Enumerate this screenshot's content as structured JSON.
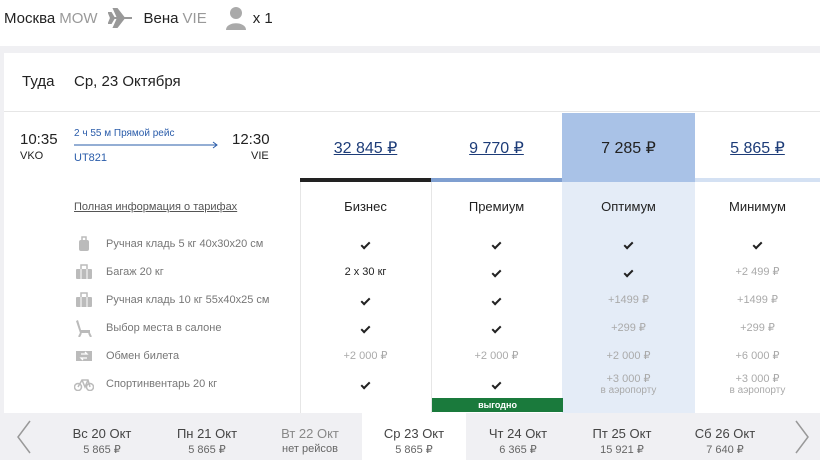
{
  "route": {
    "from_city": "Москва",
    "from_code": "MOW",
    "to_city": "Вена",
    "to_code": "VIE",
    "passengers": "x 1"
  },
  "direction": {
    "label": "Туда",
    "date": "Ср, 23 Октября"
  },
  "flight": {
    "dep_time": "10:35",
    "dep_code": "VKO",
    "arr_time": "12:30",
    "arr_code": "VIE",
    "duration": "2 ч 55 м  Прямой рейс",
    "number": "UT821"
  },
  "fares": [
    {
      "name": "Бизнес",
      "price": "32 845 ₽",
      "color": "#222222"
    },
    {
      "name": "Премиум",
      "price": "9 770 ₽",
      "color": "#7f9fd0"
    },
    {
      "name": "Оптимум",
      "price": "7 285 ₽",
      "color": "#a9c2e7"
    },
    {
      "name": "Минимум",
      "price": "5 865 ₽",
      "color": "#d4e1f3"
    }
  ],
  "info_link": "Полная информация о тарифах",
  "features": [
    {
      "icon": "hand-luggage-icon",
      "label": "Ручная кладь 5 кг 40x30x20 см"
    },
    {
      "icon": "baggage-icon",
      "label": "Багаж 20 кг"
    },
    {
      "icon": "suitcase-icon",
      "label": "Ручная кладь 10 кг 55x40x25 см"
    },
    {
      "icon": "seat-icon",
      "label": "Выбор места в салоне"
    },
    {
      "icon": "ticket-exchange-icon",
      "label": "Обмен билета"
    },
    {
      "icon": "bicycle-icon",
      "label": "Спортинвентарь 20 кг"
    }
  ],
  "cells": {
    "business": [
      "check",
      "2 x 30 кг",
      "check",
      "check",
      "+2 000 ₽",
      "check"
    ],
    "premium": [
      "check",
      "check",
      "check",
      "check",
      "+2 000 ₽",
      "check"
    ],
    "optimum": [
      "check",
      "check",
      "+1499 ₽",
      "+299 ₽",
      "+2 000 ₽",
      "+3 000 ₽"
    ],
    "minimum": [
      "check",
      "+2 499 ₽",
      "+1499 ₽",
      "+299 ₽",
      "+6 000 ₽",
      "+3 000 ₽"
    ]
  },
  "airport_note": "в аэропорту",
  "badge": "выгодно",
  "dates": [
    {
      "day": "Вс 20 Окт",
      "price": "5 865 ₽"
    },
    {
      "day": "Пн 21 Окт",
      "price": "5 865 ₽"
    },
    {
      "day": "Вт 22 Окт",
      "price": "нет рейсов"
    },
    {
      "day": "Ср 23 Окт",
      "price": "5 865 ₽"
    },
    {
      "day": "Чт 24 Окт",
      "price": "6 365 ₽"
    },
    {
      "day": "Пт 25 Окт",
      "price": "15 921 ₽"
    },
    {
      "day": "Сб 26 Окт",
      "price": "7 640 ₽"
    }
  ]
}
